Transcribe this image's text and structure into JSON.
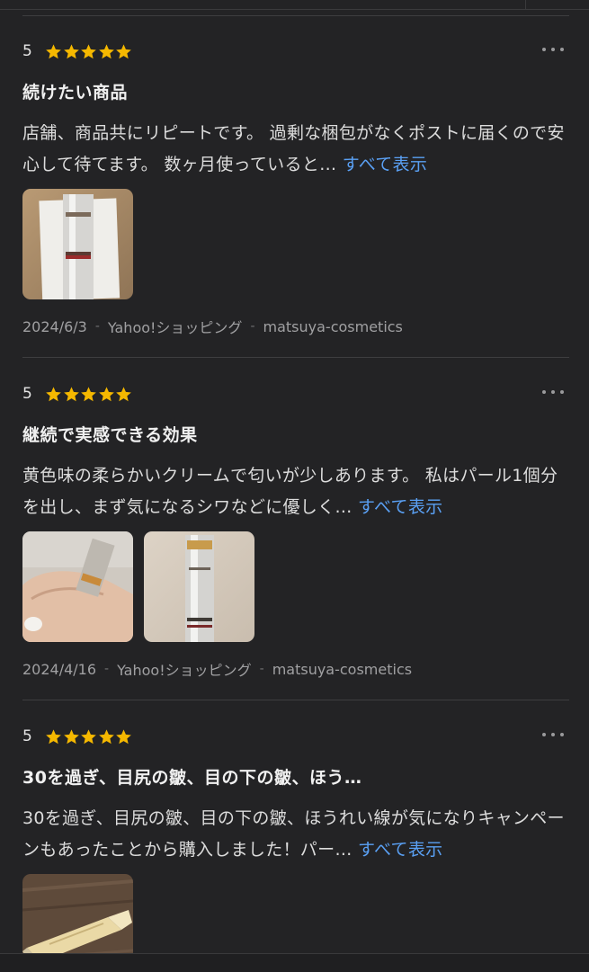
{
  "colors": {
    "background": "#232325",
    "star": "#f5b800",
    "link": "#5aa0f4"
  },
  "reviews": [
    {
      "rating": "5",
      "title": "続けたい商品",
      "body": "店舗、商品共にリピートです。 過剰な梱包がなくポストに届くので安心して待てます。 数ヶ月使っていると…",
      "show_all": "すべて表示",
      "date": "2024/6/3",
      "source": "Yahoo!ショッピング",
      "seller": "matsuya-cosmetics",
      "images": [
        "product-tube-photo"
      ]
    },
    {
      "rating": "5",
      "title": "継続で実感できる効果",
      "body": "黄色味の柔らかいクリームで匂いが少しあります。 私はパール1個分を出し、まず気になるシワなどに優しく…",
      "show_all": "すべて表示",
      "date": "2024/4/16",
      "source": "Yahoo!ショッピング",
      "seller": "matsuya-cosmetics",
      "images": [
        "cream-on-hand-photo",
        "product-tube-photo"
      ]
    },
    {
      "rating": "5",
      "title": "30を過ぎ、目尻の皺、目の下の皺、ほう…",
      "body": "30を過ぎ、目尻の皺、目の下の皺、ほうれい線が気になりキャンペーンもあったことから購入しました！パー…",
      "show_all": "すべて表示",
      "images": [
        "tube-on-wood-photo"
      ]
    }
  ]
}
